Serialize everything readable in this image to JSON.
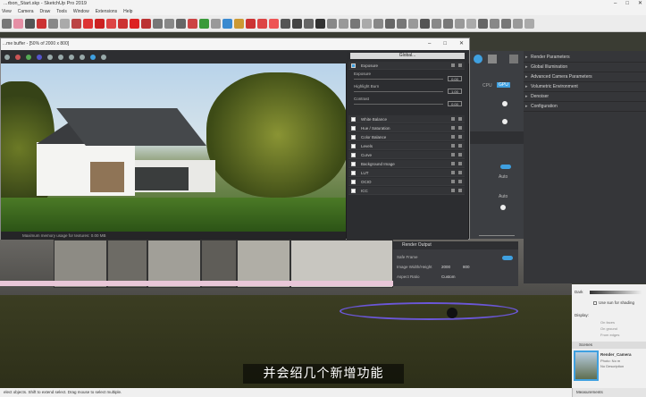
{
  "app": {
    "title": "...rbon_Start.skp - SketchUp Pro 2019",
    "window_controls": [
      "–",
      "□",
      "✕"
    ]
  },
  "menu": [
    "View",
    "Camera",
    "Draw",
    "Tools",
    "Window",
    "Extensions",
    "Help"
  ],
  "frame_buffer": {
    "title": "...me buffer - [50% of 2000 x 800]",
    "status": "Maximum memory usage for textures: 0.00 MB"
  },
  "post": {
    "button": "Global...",
    "exposure_header": "Exposure",
    "sliders": [
      {
        "label": "Exposure",
        "value": "0.00"
      },
      {
        "label": "Highlight Burn",
        "value": "1.00"
      },
      {
        "label": "Contrast",
        "value": "0.00"
      }
    ],
    "layers": [
      "White Balance",
      "Hue / Saturation",
      "Color Balance",
      "Levels",
      "Curve",
      "Background Image",
      "LUT",
      "OCIO",
      "ICC"
    ]
  },
  "asset_editor": {
    "cpu": "CPU",
    "gpu": "GPU",
    "auto1": "Auto",
    "auto2": "Auto"
  },
  "render_output": {
    "header": "Render Output",
    "safe_frame": "Safe Frame",
    "size_label": "Image Width/Height",
    "width": "2000",
    "height": "800",
    "aspect_label": "Aspect Ratio",
    "aspect_value": "Custom"
  },
  "settings": [
    "Render Parameters",
    "Global Illumination",
    "Advanced Camera Parameters",
    "Volumetric Environment",
    "Denoiser",
    "Configuration"
  ],
  "tray": {
    "dark": "Dark",
    "use_sun": "Use sun for shading",
    "display": "Display:",
    "on_faces": "On faces",
    "on_ground": "On ground",
    "from_edges": "From edges",
    "scenes": "Scenes",
    "scene_name": "Render_Camera",
    "scene_photo": "Photo: No m",
    "scene_desc": "No Description"
  },
  "status_bar": "elect objects. Shift to extend select. Drag mouse to select multiple.",
  "measurements": "Measurements",
  "subtitle": "并会绍几个新增功能",
  "colors": {
    "accent": "#3fa0e0",
    "toolbar_icon_red": "#d23a2e",
    "toolbar_icon_green": "#3a9a3a"
  }
}
